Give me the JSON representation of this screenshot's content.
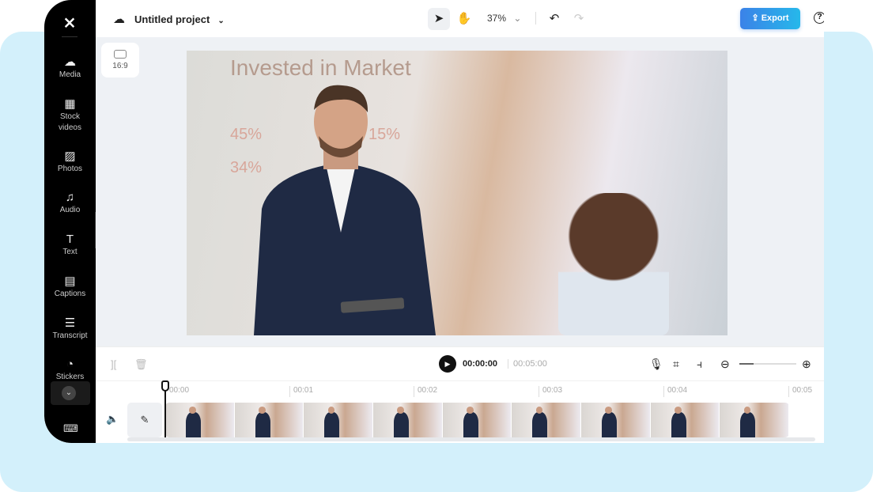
{
  "sidebar": {
    "items": [
      {
        "label": "Media",
        "icon": "cloud-upload-icon"
      },
      {
        "label": "Stock videos",
        "icon": "film-icon"
      },
      {
        "label": "Photos",
        "icon": "image-icon"
      },
      {
        "label": "Audio",
        "icon": "music-note-icon"
      },
      {
        "label": "Text",
        "icon": "text-icon"
      },
      {
        "label": "Captions",
        "icon": "captions-icon"
      },
      {
        "label": "Transcript",
        "icon": "transcript-icon"
      },
      {
        "label": "Stickers",
        "icon": "sticker-icon"
      }
    ]
  },
  "header": {
    "project_title": "Untitled project",
    "zoom": "37%",
    "export_label": "Export"
  },
  "canvas": {
    "aspect_ratio": "16:9",
    "video_text": {
      "headline": "Invested in Market",
      "stats": [
        "45%",
        "15%",
        "34%"
      ]
    }
  },
  "timeline": {
    "current_time": "00:00:00",
    "duration": "00:05:00",
    "ruler": [
      "00:00",
      "00:01",
      "00:02",
      "00:03",
      "00:04",
      "00:05"
    ]
  }
}
